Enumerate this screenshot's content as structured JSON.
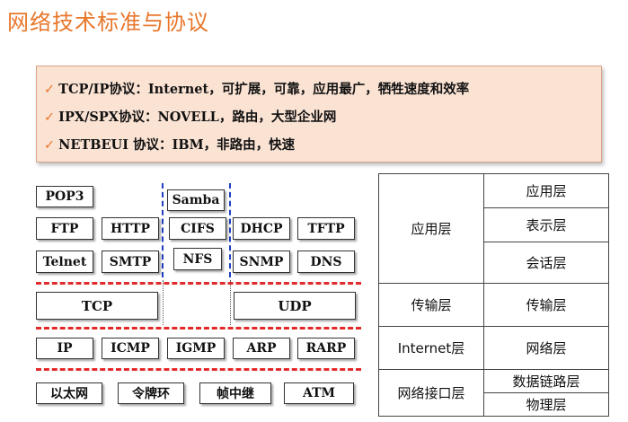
{
  "title": "网络技术标准与协议",
  "callout": {
    "check_icon": "✓",
    "bullets": [
      "TCP/IP协议：Internet，可扩展，可靠，应用最广，牺牲速度和效率",
      "IPX/SPX协议：NOVELL，路由，大型企业网",
      "NETBEUI 协议：IBM，非路由，快速"
    ]
  },
  "protocols": {
    "pop3": "POP3",
    "samba": "Samba",
    "ftp": "FTP",
    "http": "HTTP",
    "cifs": "CIFS",
    "dhcp": "DHCP",
    "tftp": "TFTP",
    "telnet": "Telnet",
    "smtp": "SMTP",
    "nfs": "NFS",
    "snmp": "SNMP",
    "dns": "DNS",
    "tcp": "TCP",
    "udp": "UDP",
    "ip": "IP",
    "icmp": "ICMP",
    "igmp": "IGMP",
    "arp": "ARP",
    "rarp": "RARP",
    "ethernet": "以太网",
    "token_ring": "令牌环",
    "frame_relay": "帧中继",
    "atm": "ATM"
  },
  "layers": {
    "tcpip": [
      "应用层",
      "传输层",
      "Internet层",
      "网络接口层"
    ],
    "osi": [
      "应用层",
      "表示层",
      "会话层",
      "传输层",
      "网络层",
      "数据链路层",
      "物理层"
    ]
  },
  "colors": {
    "title": "#e8772b",
    "separator": "#e32a2a",
    "divider": "#1f3fbf",
    "callout_bg": "#fbe3d4"
  }
}
